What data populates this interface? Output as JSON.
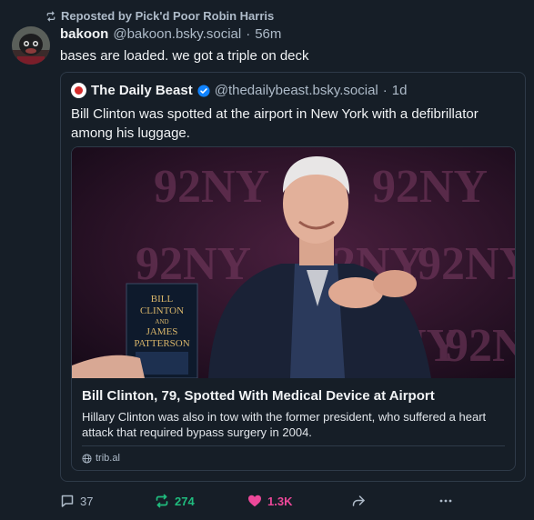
{
  "repost": {
    "label": "Reposted by Pick'd Poor Robin Harris"
  },
  "post": {
    "author_name": "bakoon",
    "author_handle": "@bakoon.bsky.social",
    "separator": "·",
    "time": "56m",
    "text": "bases are loaded. we got a triple on deck"
  },
  "quote": {
    "author_name": "The Daily Beast",
    "author_handle": "@thedailybeast.bsky.social",
    "separator": "·",
    "time": "1d",
    "text": "Bill Clinton was spotted at the airport in New York with a defibrillator among his luggage.",
    "card": {
      "title": "Bill Clinton, 79, Spotted With Medical Device at Airport",
      "description": "Hillary Clinton was also in tow with the former president, who suffered a heart attack that required bypass surgery in 2004.",
      "domain": "trib.al",
      "image_backdrop_text": "92NY",
      "book_lines": [
        "BILL",
        "CLINTON",
        "AND",
        "JAMES",
        "PATTERSON"
      ]
    }
  },
  "actions": {
    "reply_count": "37",
    "repost_count": "274",
    "like_count": "1.3K"
  },
  "colors": {
    "background": "#161e27",
    "repost_green": "#20bc7e",
    "like_pink": "#ec4899",
    "verified_blue": "#1083fe"
  }
}
